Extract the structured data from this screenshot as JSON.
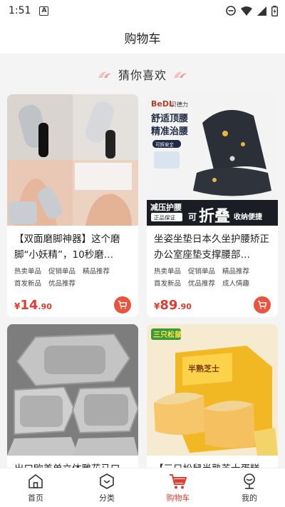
{
  "status_bar": {
    "time": "1:51",
    "notif_letter": "A"
  },
  "header": {
    "title": "购物车"
  },
  "guess": {
    "title": "猜你喜欢"
  },
  "products": [
    {
      "title": "【双面磨脚神器】这个磨脚“小妖精”，10秒磨…",
      "tags": [
        "热卖单品",
        "促销单品",
        "精品推荐",
        "首发新品",
        "优品推荐"
      ],
      "price_symbol": "¥",
      "price_int": "14",
      "price_dec": ".90"
    },
    {
      "title": "坐姿坐垫日本久坐护腰矫正办公室座垫支撑腰部…",
      "tags": [
        "热卖单品",
        "促销单品",
        "精品推荐",
        "首发新品",
        "优品推荐",
        "成人情趣"
      ],
      "price_symbol": "¥",
      "price_int": "89",
      "price_dec": ".90",
      "img_text": {
        "brand": "BeDL",
        "brand_cn": "贝德力",
        "line1": "舒适顶腰",
        "line2": "精准治腰",
        "badge": "可拆安全",
        "banner_small": "减压护腰",
        "banner_tag": "正品保证",
        "banner_can": "可",
        "banner_big": "折叠",
        "banner_tail": "收纳便捷"
      }
    },
    {
      "title": "出口欧美单立体雕花马口"
    },
    {
      "title": "【三只松鼠半熟芝士蛋糕",
      "img_text": {
        "logo": "三只松鼠",
        "box_text": "半熟芝士"
      }
    }
  ],
  "nav": [
    {
      "label": "首页",
      "icon": "home-icon"
    },
    {
      "label": "分类",
      "icon": "category-icon"
    },
    {
      "label": "购物车",
      "icon": "cart-icon",
      "active": true
    },
    {
      "label": "我的",
      "icon": "profile-icon"
    }
  ],
  "colors": {
    "accent": "#e23b2d",
    "cart_button": "#e8543f"
  }
}
